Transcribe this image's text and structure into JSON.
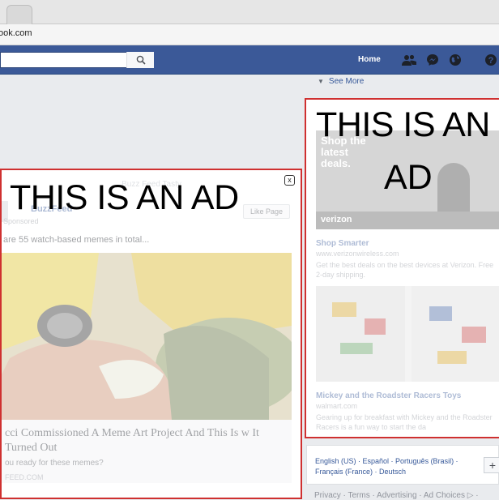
{
  "browser": {
    "url": "ook.com"
  },
  "topbar": {
    "home_label": "Home",
    "icons": [
      "friends-icon",
      "messenger-icon",
      "globe-icon",
      "help-icon"
    ]
  },
  "feed_ad": {
    "overlay_text": "THIS IS AN AD",
    "header_line": "Buzz Feed Tasty",
    "page_name": "BuzzFeed",
    "sponsored": "Sponsored",
    "like_button": "Like Page",
    "caption": "are 55 watch-based memes in total...",
    "headline": "cci Commissioned A Meme Art Project And This Is w It Turned Out",
    "subtitle": "ou ready for these memes?",
    "domain": "FEED.COM",
    "close_label": "x"
  },
  "right_col": {
    "see_more": "See More",
    "overlay_line_1": "THIS IS AN",
    "overlay_line_2": "AD",
    "ad1": {
      "banner_text": "Shop the latest deals.",
      "brand": "verizon",
      "title": "Shop Smarter",
      "url": "www.verizonwireless.com",
      "desc": "Get the best deals on the best devices at Verizon. Free 2-day shipping."
    },
    "ad2": {
      "title": "Mickey and the Roadster Racers Toys",
      "url": "walmart.com",
      "desc": "Gearing up for breakfast with Mickey and the Roadster Racers is a fun way to start the da"
    },
    "languages": {
      "line1": "English (US) · Español · Português (Brasil) ·",
      "line2": "Français (France) · Deutsch",
      "add": "+"
    },
    "footer": "Privacy · Terms · Advertising · Ad Choices ▷ ·"
  },
  "colors": {
    "fb_blue": "#3b5998",
    "ad_border": "#cf3030",
    "link": "#365899"
  }
}
